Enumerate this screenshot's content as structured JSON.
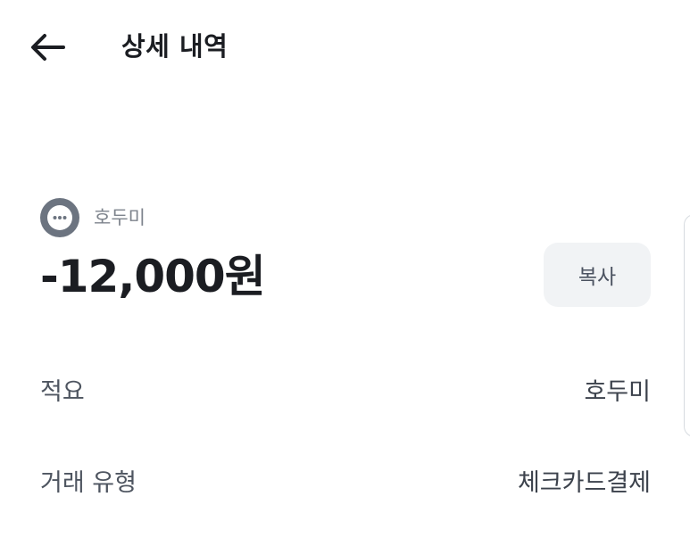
{
  "header": {
    "title": "상세 내역",
    "back_icon": "arrow-left-icon"
  },
  "transaction": {
    "merchant_icon": "more-dots-icon",
    "merchant_name": "호두미",
    "amount": "-12,000원",
    "copy_label": "복사"
  },
  "details": [
    {
      "label": "적요",
      "value": "호두미"
    },
    {
      "label": "거래 유형",
      "value": "체크카드결제"
    }
  ],
  "colors": {
    "text_primary": "#1b1d22",
    "text_secondary": "#7d838c",
    "avatar_bg": "#6c7480",
    "button_bg": "#f1f3f5"
  }
}
